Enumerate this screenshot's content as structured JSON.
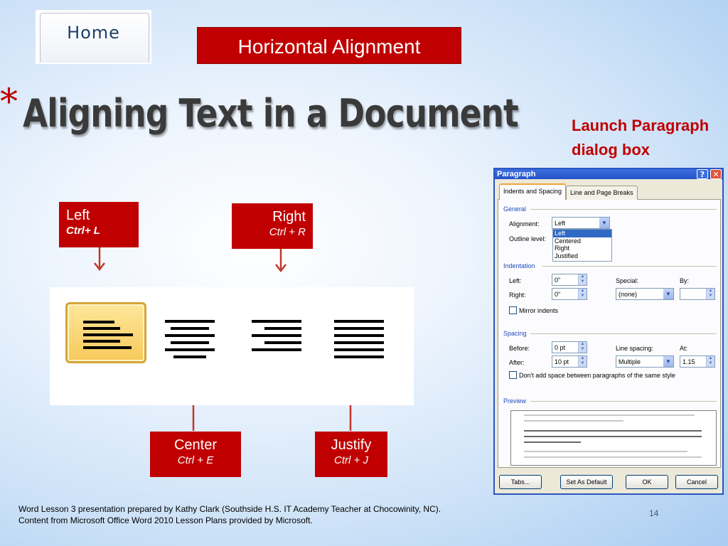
{
  "home_tab": {
    "label": "Home"
  },
  "header": {
    "title": "Horizontal Alignment"
  },
  "slide": {
    "bullet": "*",
    "title": "Aligning Text in a Document",
    "launch_label": "Launch Paragraph dialog box",
    "footer_line1": "Word Lesson 3 presentation prepared by Kathy Clark (Southside H.S. IT Academy Teacher at Chocowinity, NC).",
    "footer_line2": "Content from Microsoft Office Word 2010 Lesson Plans provided by Microsoft.",
    "page_number": "14"
  },
  "labels": {
    "left": {
      "name": "Left",
      "shortcut": "Ctrl+ L"
    },
    "right": {
      "name": "Right",
      "shortcut": "Ctrl + R"
    },
    "center": {
      "name": "Center",
      "shortcut": "Ctrl + E"
    },
    "justify": {
      "name": "Justify",
      "shortcut": "Ctrl + J"
    }
  },
  "colors": {
    "accent_red": "#c00000",
    "dialog_blue": "#2b56c0"
  },
  "dialog": {
    "title": "Paragraph",
    "help": "?",
    "close": "✕",
    "tabs": [
      "Indents and Spacing",
      "Line and Page Breaks"
    ],
    "general": {
      "section": "General",
      "alignment_label": "Alignment:",
      "alignment_value": "Left",
      "alignment_options": [
        "Left",
        "Centered",
        "Right",
        "Justified"
      ],
      "outline_label": "Outline level:"
    },
    "indentation": {
      "section": "Indentation",
      "left_label": "Left:",
      "left_value": "0\"",
      "right_label": "Right:",
      "right_value": "0\"",
      "special_label": "Special:",
      "special_value": "(none)",
      "by_label": "By:",
      "mirror_label": "Mirror indents"
    },
    "spacing": {
      "section": "Spacing",
      "before_label": "Before:",
      "before_value": "0 pt",
      "after_label": "After:",
      "after_value": "10 pt",
      "line_label": "Line spacing:",
      "line_value": "Multiple",
      "at_label": "At:",
      "at_value": "1.15",
      "dont_add_label": "Don't add space between paragraphs of the same style"
    },
    "preview": {
      "section": "Preview"
    },
    "buttons": {
      "tabs": "Tabs...",
      "default": "Set As Default",
      "ok": "OK",
      "cancel": "Cancel"
    }
  }
}
